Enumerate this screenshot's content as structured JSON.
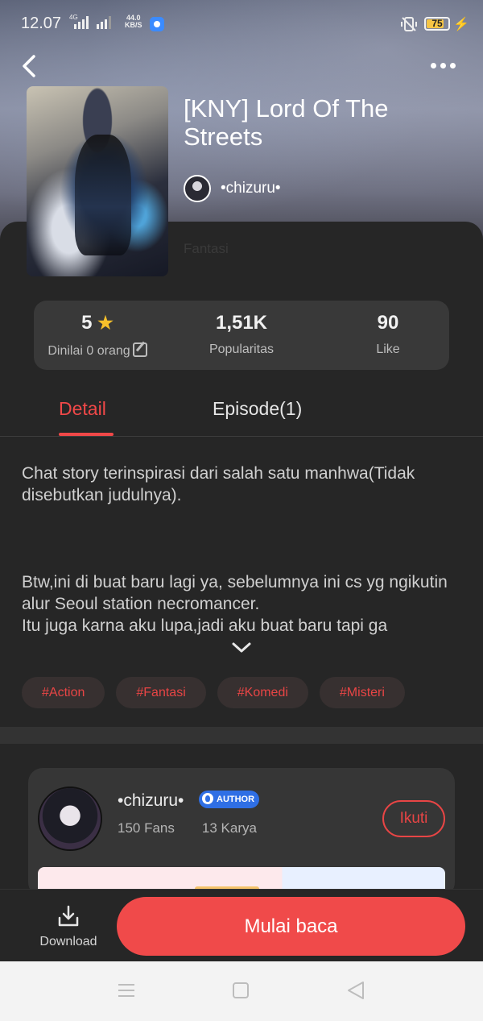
{
  "status_bar": {
    "time": "12.07",
    "network": "4G",
    "speed_value": "44.0",
    "speed_unit": "KB/S",
    "battery": "75"
  },
  "header": {
    "back_icon": "chevron-left-icon",
    "more_icon": "more-horizontal-icon"
  },
  "book": {
    "title": "[KNY] Lord Of The Streets",
    "author": "•chizuru•",
    "genre": "Fantasi"
  },
  "stats": {
    "rating_value": "5",
    "rating_label": "Dinilai 0 orang",
    "popularity_value": "1,51K",
    "popularity_label": "Popularitas",
    "like_value": "90",
    "like_label": "Like"
  },
  "tabs": {
    "detail": "Detail",
    "episode": "Episode(1)"
  },
  "description": {
    "para1": "Chat story terinspirasi dari salah satu manhwa(Tidak disebutkan judulnya).",
    "para2_line1": "Btw,ini di buat baru lagi ya, sebelumnya ini cs yg ngikutin alur Seoul station necromancer.",
    "para2_line2": "Itu juga karna aku lupa,jadi aku buat baru tapi ga"
  },
  "tags": [
    "#Action",
    "#Fantasi",
    "#Komedi",
    "#Misteri"
  ],
  "author_card": {
    "name": "•chizuru•",
    "badge": "AUTHOR",
    "fans": "150 Fans",
    "works": "13 Karya",
    "follow_label": "Ikuti"
  },
  "bottom": {
    "download_label": "Download",
    "start_label": "Mulai baca"
  },
  "colors": {
    "accent": "#f04a4a",
    "star": "#f7c02b",
    "background": "#262626",
    "badge": "#2f6fe5"
  }
}
